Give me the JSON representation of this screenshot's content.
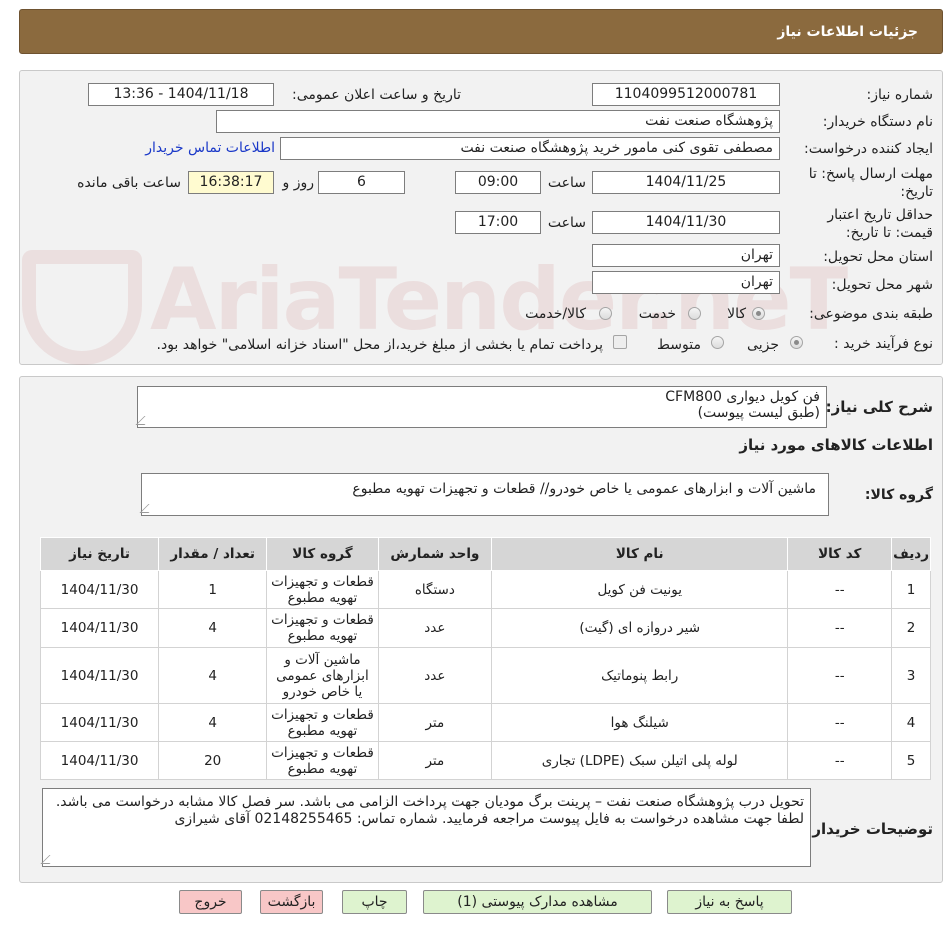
{
  "header": {
    "title": "جزئیات اطلاعات نیاز"
  },
  "watermark": "AriaTender.neT",
  "info": {
    "need_number_label": "شماره نیاز:",
    "need_number": "1104099512000781",
    "announce_label": "تاریخ و ساعت اعلان عمومی:",
    "announce_value": "1404/11/18 - 13:36",
    "buyer_label": "نام دستگاه خریدار:",
    "buyer_value": "پژوهشگاه صنعت نفت",
    "creator_label": "ایجاد کننده درخواست:",
    "creator_value": "مصطفی تقوی کنی مامور خرید پژوهشگاه صنعت نفت",
    "contact_link": "اطلاعات تماس خریدار",
    "reply_deadline_label": "مهلت ارسال پاسخ: تا تاریخ:",
    "reply_date": "1404/11/25",
    "time_label": "ساعت",
    "reply_time": "09:00",
    "days_value": "6",
    "days_label": "روز و",
    "remaining_time": "16:38:17",
    "remaining_label": "ساعت باقی مانده",
    "validity_label": "حداقل تاریخ اعتبار قیمت: تا تاریخ:",
    "validity_date": "1404/11/30",
    "validity_time": "17:00",
    "province_label": "استان محل تحویل:",
    "province_value": "تهران",
    "city_label": "شهر محل تحویل:",
    "city_value": "تهران",
    "category_label": "طبقه بندی موضوعی:",
    "category_options": [
      "کالا",
      "خدمت",
      "کالا/خدمت"
    ],
    "process_label": "نوع فرآیند خرید :",
    "process_options": [
      "جزیی",
      "متوسط"
    ],
    "process_note": "پرداخت تمام یا بخشی از مبلغ خرید،از محل \"اسناد خزانه اسلامی\" خواهد بود."
  },
  "summary": {
    "label": "شرح کلی نیاز:",
    "line1": "فن کویل دیواری CFM800",
    "line2": "(طبق لیست پیوست)"
  },
  "goods": {
    "section_title": "اطلاعات کالاهای مورد نیاز",
    "group_label": "گروه کالا:",
    "group_value": "ماشین آلات و ابزارهای عمومی یا خاص خودرو//  قطعات و تجهیزات تهویه مطبوع"
  },
  "table": {
    "headers": [
      "ردیف",
      "کد کالا",
      "نام کالا",
      "واحد شمارش",
      "گروه کالا",
      "تعداد / مقدار",
      "تاریخ نیاز"
    ],
    "rows": [
      [
        "1",
        "--",
        "یونیت فن کویل",
        "دستگاه",
        "قطعات و تجهیزات تهویه مطبوع",
        "1",
        "1404/11/30"
      ],
      [
        "2",
        "--",
        "شیر دروازه ای (گیت)",
        "عدد",
        "قطعات و تجهیزات تهویه مطبوع",
        "4",
        "1404/11/30"
      ],
      [
        "3",
        "--",
        "رابط پنوماتیک",
        "عدد",
        "ماشین آلات و ابزارهای عمومی یا خاص خودرو",
        "4",
        "1404/11/30"
      ],
      [
        "4",
        "--",
        "شیلنگ هوا",
        "متر",
        "قطعات و تجهیزات تهویه مطبوع",
        "4",
        "1404/11/30"
      ],
      [
        "5",
        "--",
        "لوله پلی اتیلن سبک (LDPE) تجاری",
        "متر",
        "قطعات و تجهیزات تهویه مطبوع",
        "20",
        "1404/11/30"
      ]
    ]
  },
  "buyer_notes": {
    "label": "توضیحات خریدار:",
    "text": "تحویل درب پژوهشگاه صنعت نفت – پرینت برگ مودیان جهت پرداخت الزامی می باشد. سر فصل کالا مشابه درخواست می باشد. لطفا جهت مشاهده درخواست به فایل پیوست مراجعه فرمایید. شماره تماس: 02148255465 آقای شیرازی"
  },
  "buttons": {
    "reply": "پاسخ به نیاز",
    "attachments": "مشاهده مدارک پیوستی (1)",
    "print": "چاپ",
    "back": "بازگشت",
    "exit": "خروج"
  }
}
